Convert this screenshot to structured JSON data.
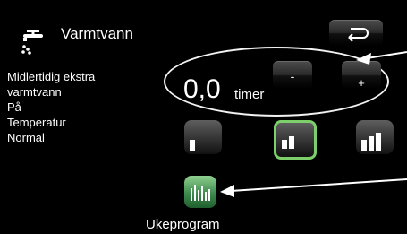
{
  "screen": {
    "title": "Varmtvann",
    "info_lines": [
      "Midlertidig ekstra",
      "varmtvann",
      "På",
      "Temperatur",
      "Normal"
    ]
  },
  "extra_hot_water": {
    "value": "0,0",
    "unit": "timer",
    "minus_label": "-",
    "plus_label": "+"
  },
  "temperature_levels": {
    "options": [
      "low",
      "normal",
      "high"
    ],
    "selected": "normal"
  },
  "ukeprogram": {
    "label": "Ukeprogram"
  },
  "colors": {
    "background": "#000000",
    "text": "#ffffff",
    "selected_border": "#7ccf6a",
    "program_button": "#3e8a4e"
  },
  "icons": {
    "header": "hot-water-tap-icon",
    "back": "return-arrow-icon",
    "program": "bar-chart-icon"
  }
}
